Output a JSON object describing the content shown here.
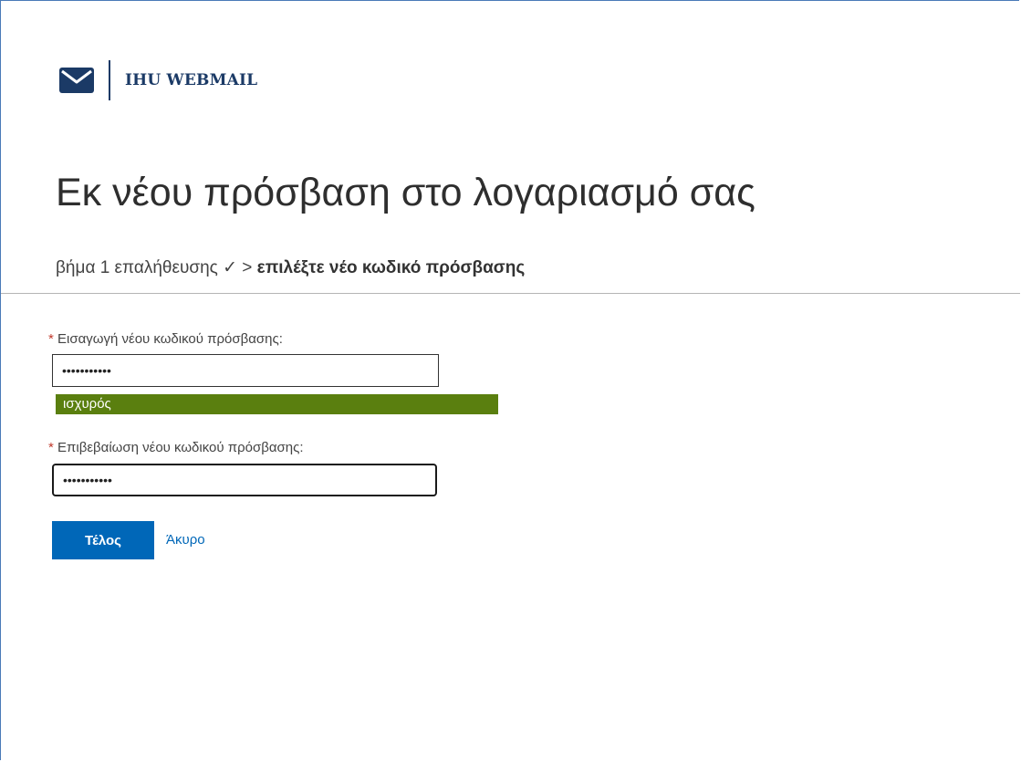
{
  "brand": {
    "name": "IHU WEBMAIL",
    "icon": "envelope-icon",
    "color": "#1b3a66"
  },
  "page": {
    "title": "Εκ νέου πρόσβαση στο λογαριασμό σας"
  },
  "breadcrumb": {
    "step1": "βήμα 1 επαλήθευσης ✓",
    "separator": ">",
    "current": "επιλέξτε νέο κωδικό πρόσβασης"
  },
  "form": {
    "new_password": {
      "required_mark": "*",
      "label": "Εισαγωγή νέου κωδικού πρόσβασης:",
      "value": "abcdefghijk"
    },
    "strength": {
      "label": "ισχυρός",
      "level": 1.0,
      "color": "#5a7f0f"
    },
    "confirm_password": {
      "required_mark": "*",
      "label": "Επιβεβαίωση νέου κωδικού πρόσβασης:",
      "value": "abcdefghijk"
    }
  },
  "actions": {
    "finish_label": "Τέλος",
    "cancel_label": "Άκυρο",
    "accent_color": "#0067b8"
  }
}
